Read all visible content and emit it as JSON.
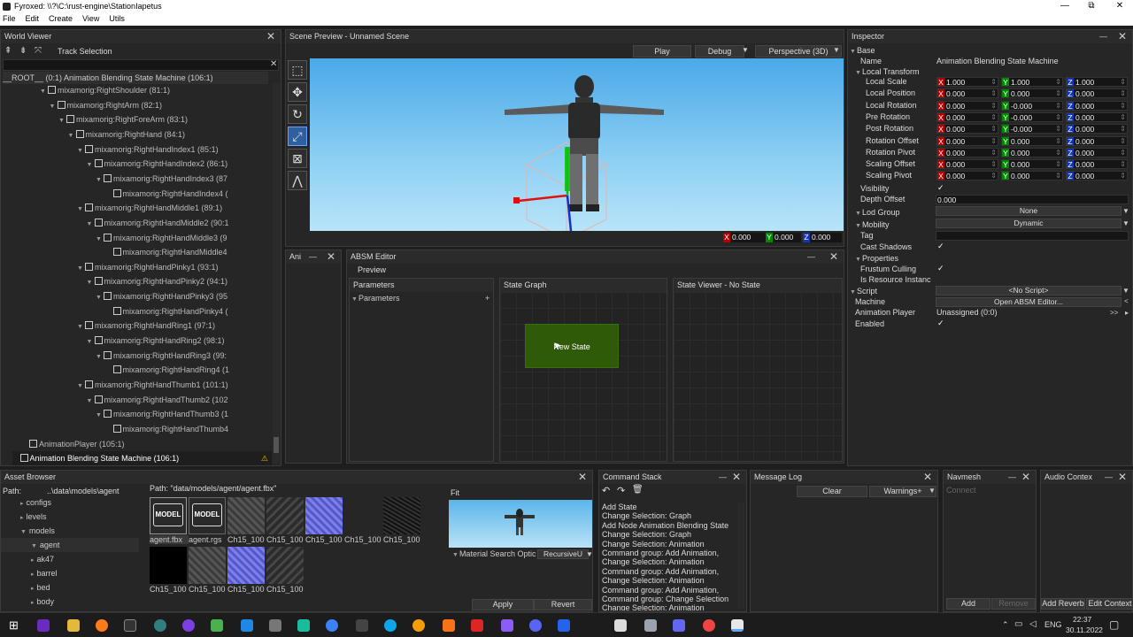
{
  "window": {
    "title": "Fyroxed: \\\\?\\C:\\rust-engine\\StationIapetus",
    "min": "—",
    "max": "⧉",
    "close": "✕"
  },
  "menu": [
    "File",
    "Edit",
    "Create",
    "View",
    "Utils"
  ],
  "world_viewer": {
    "title": "World Viewer",
    "track_selection": "Track Selection",
    "root": "__ROOT__ (0:1) Animation Blending State Machine (106:1)",
    "rows": [
      {
        "text": "mixamorig:RightShoulder (81:1)",
        "indent": 4,
        "arrow": true
      },
      {
        "text": "mixamorig:RightArm (82:1)",
        "indent": 5,
        "arrow": true
      },
      {
        "text": "mixamorig:RightForeArm (83:1)",
        "indent": 6,
        "arrow": true
      },
      {
        "text": "mixamorig:RightHand (84:1)",
        "indent": 7,
        "arrow": true
      },
      {
        "text": "mixamorig:RightHandIndex1 (85:1)",
        "indent": 8,
        "arrow": true
      },
      {
        "text": "mixamorig:RightHandIndex2 (86:1)",
        "indent": 9,
        "arrow": true
      },
      {
        "text": "mixamorig:RightHandIndex3 (87",
        "indent": 10,
        "arrow": true
      },
      {
        "text": "mixamorig:RightHandIndex4 (",
        "indent": 11,
        "arrow": false
      },
      {
        "text": "mixamorig:RightHandMiddle1 (89:1)",
        "indent": 8,
        "arrow": true
      },
      {
        "text": "mixamorig:RightHandMiddle2 (90:1",
        "indent": 9,
        "arrow": true
      },
      {
        "text": "mixamorig:RightHandMiddle3 (9",
        "indent": 10,
        "arrow": true
      },
      {
        "text": "mixamorig:RightHandMiddle4",
        "indent": 11,
        "arrow": false
      },
      {
        "text": "mixamorig:RightHandPinky1 (93:1)",
        "indent": 8,
        "arrow": true
      },
      {
        "text": "mixamorig:RightHandPinky2 (94:1)",
        "indent": 9,
        "arrow": true
      },
      {
        "text": "mixamorig:RightHandPinky3 (95",
        "indent": 10,
        "arrow": true
      },
      {
        "text": "mixamorig:RightHandPinky4 (",
        "indent": 11,
        "arrow": false
      },
      {
        "text": "mixamorig:RightHandRing1 (97:1)",
        "indent": 8,
        "arrow": true
      },
      {
        "text": "mixamorig:RightHandRing2 (98:1)",
        "indent": 9,
        "arrow": true
      },
      {
        "text": "mixamorig:RightHandRing3 (99:",
        "indent": 10,
        "arrow": true
      },
      {
        "text": "mixamorig:RightHandRing4 (1",
        "indent": 11,
        "arrow": false
      },
      {
        "text": "mixamorig:RightHandThumb1 (101:1)",
        "indent": 8,
        "arrow": true
      },
      {
        "text": "mixamorig:RightHandThumb2 (102",
        "indent": 9,
        "arrow": true
      },
      {
        "text": "mixamorig:RightHandThumb3 (1",
        "indent": 10,
        "arrow": true
      },
      {
        "text": "mixamorig:RightHandThumb4",
        "indent": 11,
        "arrow": false
      },
      {
        "text": "AnimationPlayer (105:1)",
        "indent": 2,
        "arrow": false
      },
      {
        "text": "Animation Blending State Machine (106:1)",
        "indent": 1,
        "arrow": false,
        "selected": true
      }
    ]
  },
  "scene_preview": {
    "title": "Scene Preview - Unnamed Scene",
    "play": "Play",
    "debug": "Debug",
    "camera": "Perspective (3D)",
    "coords": {
      "x": "0.000",
      "y": "0.000",
      "z": "0.000"
    }
  },
  "anim_tab": "Ani",
  "absm": {
    "title": "ABSM Editor",
    "preview": "Preview",
    "parameters_header": "Parameters",
    "parameters_item": "Parameters",
    "state_graph": "State Graph",
    "state_viewer": "State Viewer - No State",
    "node_label": "New State"
  },
  "inspector": {
    "title": "Inspector",
    "base": "Base",
    "name_label": "Name",
    "name_value": "Animation Blending State Machine",
    "local_transform": "Local Transform",
    "vector_rows": [
      {
        "label": "Local Scale",
        "x": "1.000",
        "y": "1.000",
        "z": "1.000"
      },
      {
        "label": "Local Position",
        "x": "0.000",
        "y": "0.000",
        "z": "0.000"
      },
      {
        "label": "Local Rotation",
        "x": "0.000",
        "y": "-0.000",
        "z": "0.000"
      },
      {
        "label": "Pre Rotation",
        "x": "0.000",
        "y": "-0.000",
        "z": "0.000"
      },
      {
        "label": "Post Rotation",
        "x": "0.000",
        "y": "-0.000",
        "z": "0.000"
      },
      {
        "label": "Rotation Offset",
        "x": "0.000",
        "y": "0.000",
        "z": "0.000"
      },
      {
        "label": "Rotation Pivot",
        "x": "0.000",
        "y": "0.000",
        "z": "0.000"
      },
      {
        "label": "Scaling Offset",
        "x": "0.000",
        "y": "0.000",
        "z": "0.000"
      },
      {
        "label": "Scaling Pivot",
        "x": "0.000",
        "y": "0.000",
        "z": "0.000"
      }
    ],
    "visibility": "Visibility",
    "depth_offset": "Depth Offset",
    "depth_offset_value": "0.000",
    "lod_group": "Lod Group",
    "lod_value": "None",
    "mobility": "Mobility",
    "mobility_value": "Dynamic",
    "tag": "Tag",
    "cast_shadows": "Cast Shadows",
    "properties": "Properties",
    "frustum_culling": "Frustum Culling",
    "is_resource": "Is Resource Instanc",
    "script": "Script",
    "script_value": "<No Script>",
    "machine": "Machine",
    "machine_value": "Open ABSM Editor...",
    "animation_player": "Animation Player",
    "animation_player_value": "Unassigned (0:0)",
    "enabled": "Enabled",
    "check": "✓"
  },
  "asset_browser": {
    "title": "Asset Browser",
    "path_label": "Path:",
    "path_value": "..\\data\\models\\agent",
    "file_path": "Path: \"data/models/agent/agent.fbx\"",
    "folders": [
      {
        "name": "configs",
        "indent": 1
      },
      {
        "name": "levels",
        "indent": 1
      },
      {
        "name": "models",
        "indent": 1,
        "open": true
      },
      {
        "name": "agent",
        "indent": 2,
        "open": true,
        "selected": true
      },
      {
        "name": "ak47",
        "indent": 2
      },
      {
        "name": "barrel",
        "indent": 2
      },
      {
        "name": "bed",
        "indent": 2
      },
      {
        "name": "body",
        "indent": 2
      }
    ],
    "files": [
      {
        "name": "agent.fbx",
        "kind": "model",
        "badge": "MODEL"
      },
      {
        "name": "agent.rgs",
        "kind": "model",
        "badge": "MODEL"
      },
      {
        "name": "Ch15_100",
        "kind": "tex-gray"
      },
      {
        "name": "Ch15_100",
        "kind": "tex-dark"
      },
      {
        "name": "Ch15_100",
        "kind": "tex-blue"
      },
      {
        "name": "Ch15_100",
        "kind": "tex-black2"
      },
      {
        "name": "Ch15_100",
        "kind": "tex-noise"
      },
      {
        "name": "Ch15_100",
        "kind": "tex-black"
      },
      {
        "name": "Ch15_100",
        "kind": "tex-gray"
      },
      {
        "name": "Ch15_100",
        "kind": "tex-blue"
      },
      {
        "name": "Ch15_100",
        "kind": "tex-dark"
      }
    ],
    "fit": "Fit",
    "material_search": "Material Search Optic",
    "recursive": "RecursiveU",
    "apply": "Apply",
    "revert": "Revert"
  },
  "command_stack": {
    "title": "Command Stack",
    "lines": [
      "Add State",
      "Change Selection: Graph",
      "Add Node Animation Blending State",
      "Change Selection: Graph",
      "Change Selection: Animation",
      "Command group: Add Animation,",
      "Change Selection: Animation",
      "Command group: Add Animation,",
      "Change Selection: Animation",
      "Command group: Add Animation,",
      "Command group: Change Selection",
      "Change Selection: Animation"
    ]
  },
  "message_log": {
    "title": "Message Log",
    "clear": "Clear",
    "filter": "Warnings+"
  },
  "navmesh": {
    "title": "Navmesh",
    "connect": "Connect",
    "add": "Add",
    "remove": "Remove"
  },
  "audio": {
    "title": "Audio Contex",
    "add_reverb": "Add Reverb",
    "edit_context": "Edit Context"
  },
  "taskbar": {
    "lang": "ENG",
    "time": "22:37",
    "date": "30.11.2022"
  }
}
